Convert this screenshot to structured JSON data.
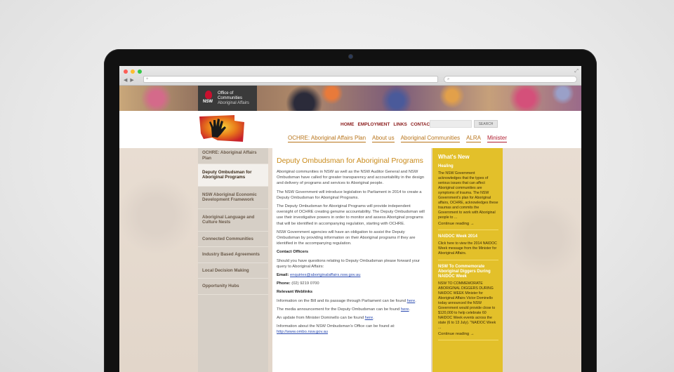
{
  "browser": {
    "url_placeholder": "",
    "search_placeholder": "",
    "back": "◀",
    "forward": "▶",
    "new_tab": "+"
  },
  "banner": {
    "org_line1": "Office of",
    "org_line2": "Communities",
    "org_line3": "Aboriginal Affairs",
    "nsw_label": "NSW"
  },
  "header": {
    "toplinks": [
      "HOME",
      "EMPLOYMENT",
      "LINKS",
      "CONTACT"
    ],
    "search_button": "SEARCH",
    "mainnav": [
      "OCHRE: Aboriginal Affairs Plan",
      "About us",
      "Aboriginal Communities",
      "ALRA",
      "Minister"
    ]
  },
  "sidebar": {
    "items": [
      "OCHRE: Aboriginal Affairs Plan",
      "Deputy Ombudsman for Aboriginal Programs",
      "NSW Aboriginal Economic Development Framework",
      "Aboriginal Language and Culture Nests",
      "Connected Communities",
      "Industry Based Agreements",
      "Local Decision Making",
      "Opportunity Hubs"
    ]
  },
  "main": {
    "title": "Deputy Ombudsman for Aboriginal Programs",
    "p1": "Aboriginal communities in NSW as well as the NSW Auditor General and NSW Ombudsman have called for greater transparency and accountability in the design and delivery of programs and services to Aboriginal people.",
    "p2": "The NSW Government will introduce legislation to Parliament in 2014 to create a Deputy Ombudsman for Aboriginal Programs.",
    "p3": "The Deputy Ombudsman for Aboriginal Programs will provide independent oversight of OCHRE creating genuine accountability. The Deputy Ombudsman will use their investigative powers in order to monitor and assess Aboriginal programs that will be identified in accompanying regulation, starting with OCHRE.",
    "p4": "NSW Government agencies will have an obligation to assist the Deputy Ombudsman by providing information on their Aboriginal programs if they are identified in the accompanying regulation.",
    "contact_heading": "Contact Officers",
    "p5": "Should you have questions relating to Deputy Ombudsman please forward your query to  Aboriginal Affairs:",
    "email_label": "Email:",
    "email": "enquiries@aboriginalaffairs.nsw.gov.au",
    "phone_label": "Phone:",
    "phone": "(02) 9219 0700",
    "weblinks_heading": "Relevant Weblinks",
    "w1": "Information on the Bill and its passage through Parliament can be found ",
    "w2": "The media announcement for the Deputy Ombudsman can be found ",
    "w3": "An update from Minister Dominello can be found ",
    "here": "here",
    "dot": ".",
    "w4": "Information about the NSW Ombudsman's Office can be found at:",
    "ombo_link": "http://www.ombo.nsw.gov.au"
  },
  "whatsnew": {
    "title": "What's New",
    "items": [
      {
        "title": "Healing",
        "body": "The NSW Government acknowledges that the types of serious issues that can affect Aboriginal communities are symptoms of trauma. The NSW Government's plan for Aboriginal affairs, OCHRE,  acknowledges these traumas and commits the Government to work with Aboriginal people to ...",
        "more": "Continue reading →"
      },
      {
        "title": "NAIDOC Week 2014",
        "body": "Click here to view the 2014 NAIDOC Week message from the Minister for Aboriginal Affairs.",
        "more": ""
      },
      {
        "title": "NSW To Commemorate Aboriginal Diggers During NAIDOC Week",
        "body": "NSW TO COMMEMORATE ABORIGINAL DIGGERS DURING NAIDOC WEEK  Minister for Aboriginal Affairs Victor Dominello today announced the NSW Government would provide close to $120,000 to help celebrate 60 NAIDOC Week events across the state (6 to 13 July). \"NAIDOC Week ...",
        "more": "Continue reading →"
      }
    ]
  }
}
